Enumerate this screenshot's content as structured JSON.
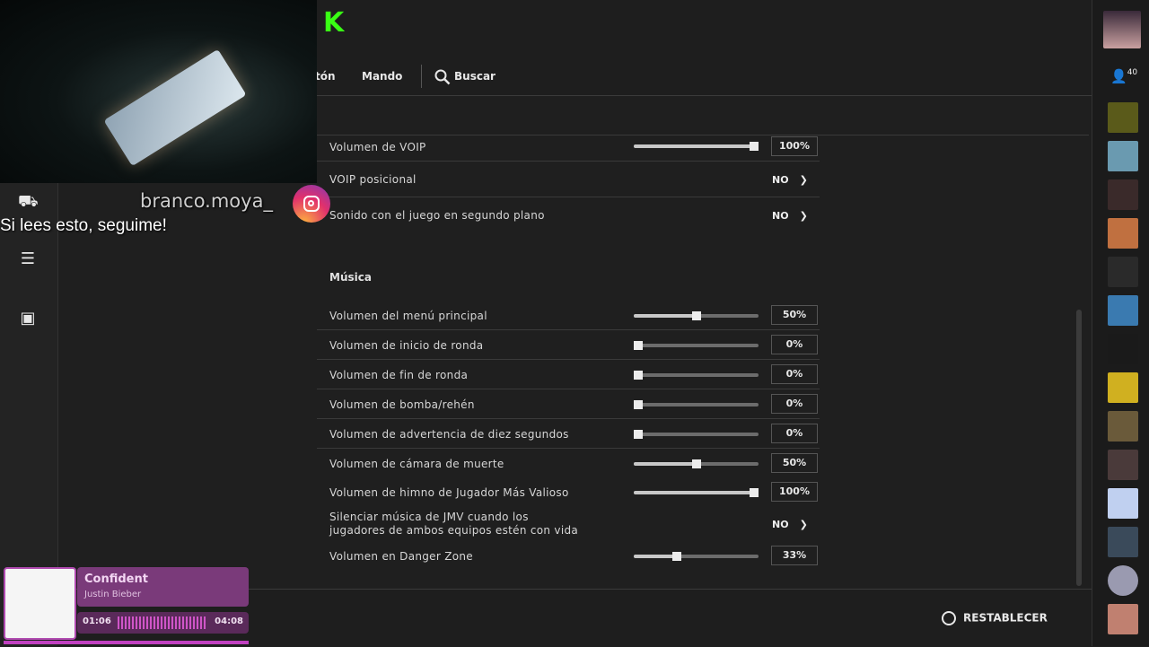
{
  "nav": {
    "partial_tab": "tón",
    "controller": "Mando",
    "search": "Buscar"
  },
  "rows_top": [
    {
      "label": "Volumen de VOIP",
      "value": "100%",
      "fraction": 1.0
    },
    {
      "label": "VOIP posicional",
      "toggle": "NO"
    },
    {
      "label": "Sonido con el juego en segundo plano",
      "toggle": "NO"
    }
  ],
  "music": {
    "section_title": "Música",
    "rows": [
      {
        "label": "Volumen del menú principal",
        "value": "50%",
        "fraction": 0.5
      },
      {
        "label": "Volumen de inicio de ronda",
        "value": "0%",
        "fraction": 0.0
      },
      {
        "label": "Volumen de fin de ronda",
        "value": "0%",
        "fraction": 0.0
      },
      {
        "label": "Volumen de bomba/rehén",
        "value": "0%",
        "fraction": 0.0
      },
      {
        "label": "Volumen de advertencia de diez segundos",
        "value": "0%",
        "fraction": 0.0
      },
      {
        "label": "Volumen de cámara de muerte",
        "value": "50%",
        "fraction": 0.5
      },
      {
        "label": "Volumen de himno de Jugador Más Valioso",
        "value": "100%",
        "fraction": 1.0
      },
      {
        "label_line1": "Silenciar música de JMV cuando los",
        "label_line2": "jugadores de ambos equipos estén con vida",
        "toggle": "NO"
      },
      {
        "label": "Volumen en Danger Zone",
        "value": "33%",
        "fraction": 0.33
      }
    ]
  },
  "reset_label": "RESTABLECER",
  "friends_count": "40",
  "stream_overlay": {
    "username": "branco.moya_",
    "message": "Si lees esto, seguime!"
  },
  "now_playing": {
    "title": "Confident",
    "artist": "Justin Bieber",
    "elapsed": "01:06",
    "duration": "04:08"
  },
  "colors": {
    "background": "#1f1f1f",
    "accent_logo": "#39ff14",
    "player_purple": "#7a3a7a"
  }
}
